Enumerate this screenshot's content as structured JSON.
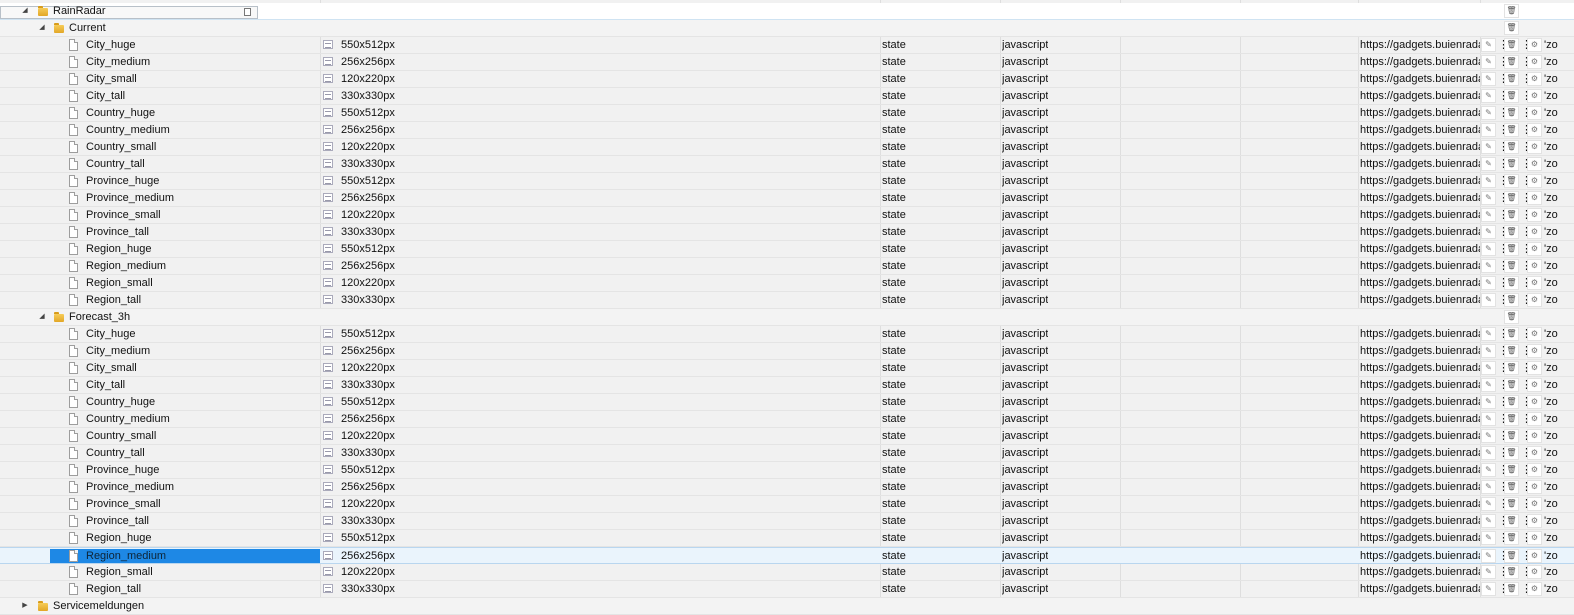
{
  "tree": {
    "root": {
      "label": "RainRadar",
      "toggle": "◢",
      "trash_icon": "🗑"
    },
    "folders": [
      {
        "label": "Current",
        "toggle": "◢",
        "items": [
          {
            "name": "City_huge",
            "size": "550x512px",
            "type": "state",
            "lang": "javascript",
            "url": "https://gadgets.buienradar",
            "extra": "'zo"
          },
          {
            "name": "City_medium",
            "size": "256x256px",
            "type": "state",
            "lang": "javascript",
            "url": "https://gadgets.buienradar",
            "extra": "'zo"
          },
          {
            "name": "City_small",
            "size": "120x220px",
            "type": "state",
            "lang": "javascript",
            "url": "https://gadgets.buienradar",
            "extra": "'zo"
          },
          {
            "name": "City_tall",
            "size": "330x330px",
            "type": "state",
            "lang": "javascript",
            "url": "https://gadgets.buienradar",
            "extra": "'zo"
          },
          {
            "name": "Country_huge",
            "size": "550x512px",
            "type": "state",
            "lang": "javascript",
            "url": "https://gadgets.buienradar",
            "extra": "'zo"
          },
          {
            "name": "Country_medium",
            "size": "256x256px",
            "type": "state",
            "lang": "javascript",
            "url": "https://gadgets.buienradar",
            "extra": "'zo"
          },
          {
            "name": "Country_small",
            "size": "120x220px",
            "type": "state",
            "lang": "javascript",
            "url": "https://gadgets.buienradar",
            "extra": "'zo"
          },
          {
            "name": "Country_tall",
            "size": "330x330px",
            "type": "state",
            "lang": "javascript",
            "url": "https://gadgets.buienradar",
            "extra": "'zo"
          },
          {
            "name": "Province_huge",
            "size": "550x512px",
            "type": "state",
            "lang": "javascript",
            "url": "https://gadgets.buienradar",
            "extra": "'zo"
          },
          {
            "name": "Province_medium",
            "size": "256x256px",
            "type": "state",
            "lang": "javascript",
            "url": "https://gadgets.buienradar",
            "extra": "'zo"
          },
          {
            "name": "Province_small",
            "size": "120x220px",
            "type": "state",
            "lang": "javascript",
            "url": "https://gadgets.buienradar",
            "extra": "'zo"
          },
          {
            "name": "Province_tall",
            "size": "330x330px",
            "type": "state",
            "lang": "javascript",
            "url": "https://gadgets.buienradar",
            "extra": "'zo"
          },
          {
            "name": "Region_huge",
            "size": "550x512px",
            "type": "state",
            "lang": "javascript",
            "url": "https://gadgets.buienradar",
            "extra": "'zo"
          },
          {
            "name": "Region_medium",
            "size": "256x256px",
            "type": "state",
            "lang": "javascript",
            "url": "https://gadgets.buienradar",
            "extra": "'zo"
          },
          {
            "name": "Region_small",
            "size": "120x220px",
            "type": "state",
            "lang": "javascript",
            "url": "https://gadgets.buienradar",
            "extra": "'zo"
          },
          {
            "name": "Region_tall",
            "size": "330x330px",
            "type": "state",
            "lang": "javascript",
            "url": "https://gadgets.buienradar",
            "extra": "'zo"
          }
        ]
      },
      {
        "label": "Forecast_3h",
        "toggle": "◢",
        "items": [
          {
            "name": "City_huge",
            "size": "550x512px",
            "type": "state",
            "lang": "javascript",
            "url": "https://gadgets.buienradar",
            "extra": "'zo"
          },
          {
            "name": "City_medium",
            "size": "256x256px",
            "type": "state",
            "lang": "javascript",
            "url": "https://gadgets.buienradar",
            "extra": "'zo"
          },
          {
            "name": "City_small",
            "size": "120x220px",
            "type": "state",
            "lang": "javascript",
            "url": "https://gadgets.buienradar",
            "extra": "'zo"
          },
          {
            "name": "City_tall",
            "size": "330x330px",
            "type": "state",
            "lang": "javascript",
            "url": "https://gadgets.buienradar",
            "extra": "'zo"
          },
          {
            "name": "Country_huge",
            "size": "550x512px",
            "type": "state",
            "lang": "javascript",
            "url": "https://gadgets.buienradar",
            "extra": "'zo"
          },
          {
            "name": "Country_medium",
            "size": "256x256px",
            "type": "state",
            "lang": "javascript",
            "url": "https://gadgets.buienradar",
            "extra": "'zo"
          },
          {
            "name": "Country_small",
            "size": "120x220px",
            "type": "state",
            "lang": "javascript",
            "url": "https://gadgets.buienradar",
            "extra": "'zo"
          },
          {
            "name": "Country_tall",
            "size": "330x330px",
            "type": "state",
            "lang": "javascript",
            "url": "https://gadgets.buienradar",
            "extra": "'zo"
          },
          {
            "name": "Province_huge",
            "size": "550x512px",
            "type": "state",
            "lang": "javascript",
            "url": "https://gadgets.buienradar",
            "extra": "'zo"
          },
          {
            "name": "Province_medium",
            "size": "256x256px",
            "type": "state",
            "lang": "javascript",
            "url": "https://gadgets.buienradar",
            "extra": "'zo"
          },
          {
            "name": "Province_small",
            "size": "120x220px",
            "type": "state",
            "lang": "javascript",
            "url": "https://gadgets.buienradar",
            "extra": "'zo"
          },
          {
            "name": "Province_tall",
            "size": "330x330px",
            "type": "state",
            "lang": "javascript",
            "url": "https://gadgets.buienradar",
            "extra": "'zo"
          },
          {
            "name": "Region_huge",
            "size": "550x512px",
            "type": "state",
            "lang": "javascript",
            "url": "https://gadgets.buienradar",
            "extra": "'zo"
          },
          {
            "name": "Region_medium",
            "size": "256x256px",
            "type": "state",
            "lang": "javascript",
            "url": "https://gadgets.buienradar",
            "extra": "'zo",
            "selected": true
          },
          {
            "name": "Region_small",
            "size": "120x220px",
            "type": "state",
            "lang": "javascript",
            "url": "https://gadgets.buienradar",
            "extra": "'zo"
          },
          {
            "name": "Region_tall",
            "size": "330x330px",
            "type": "state",
            "lang": "javascript",
            "url": "https://gadgets.buienradar",
            "extra": "'zo"
          }
        ]
      }
    ],
    "partial_folder": {
      "label": "Servicemeldungen",
      "toggle": "▶"
    }
  },
  "icons": {
    "edit": "✎",
    "trash": "🗑",
    "settings": "⚙",
    "more": "⋮"
  },
  "colors": {
    "selection": "#1e88e5",
    "folder": "#e9b23a"
  }
}
